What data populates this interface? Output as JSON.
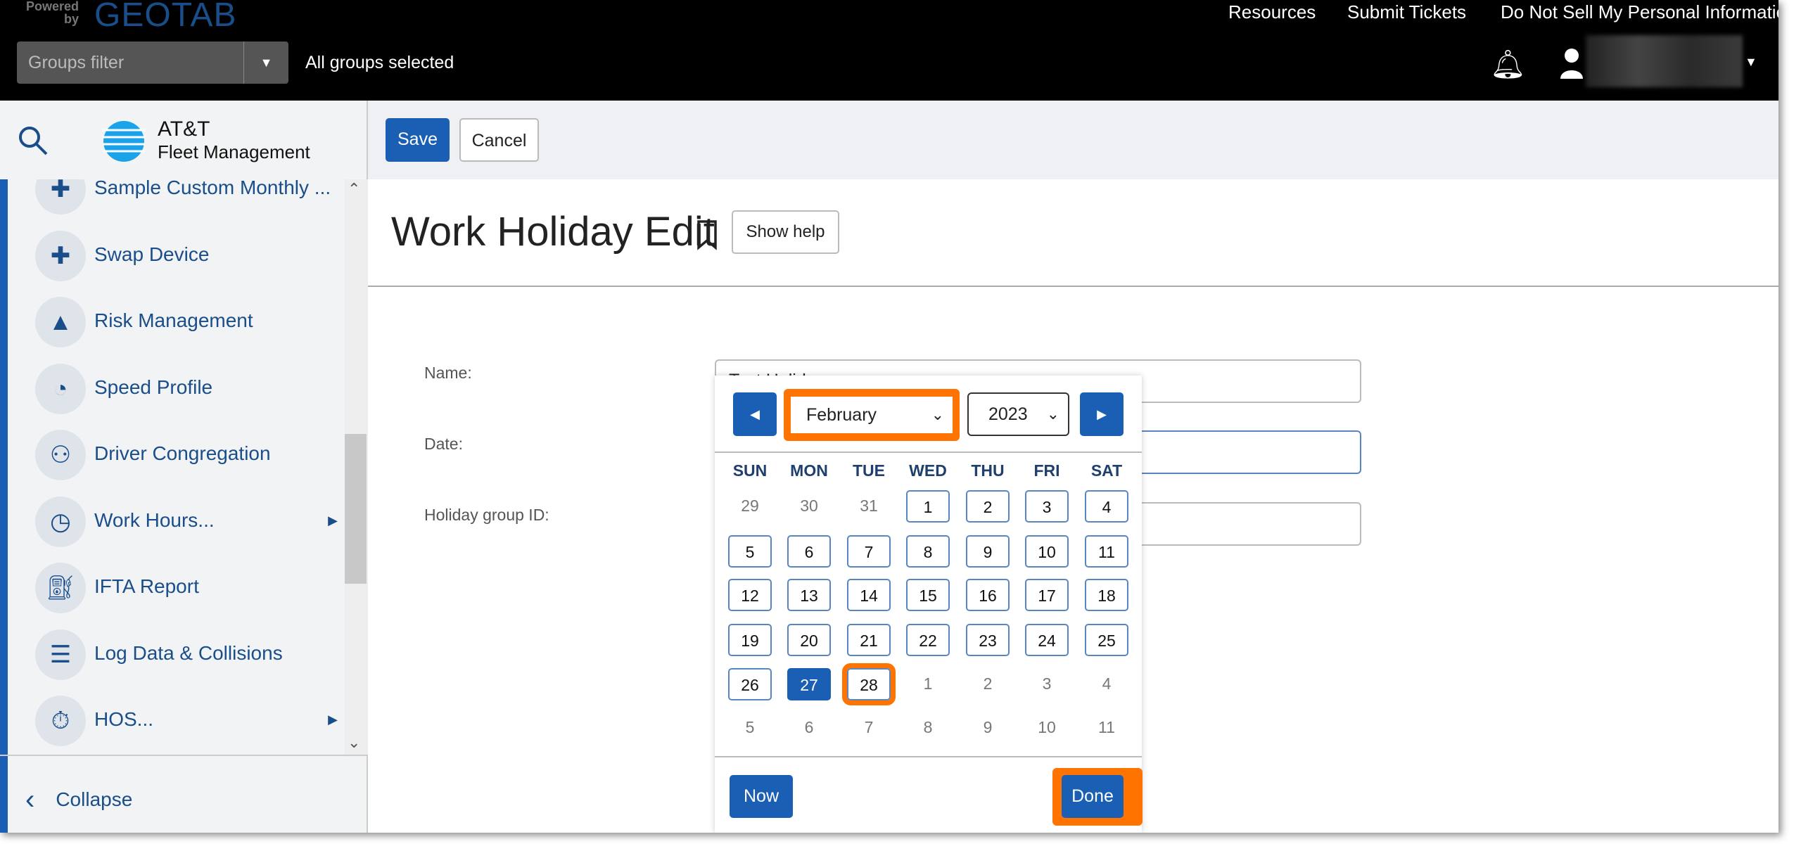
{
  "topbar": {
    "powered_by": "Powered by",
    "brand": "GEOTAB",
    "links": [
      "Resources",
      "Submit Tickets",
      "Do Not Sell My Personal Information"
    ],
    "groups_filter_placeholder": "Groups filter",
    "groups_status": "All groups selected"
  },
  "sidebar": {
    "logo_line1": "AT&T",
    "logo_line2": "Fleet Management",
    "items": [
      {
        "label": "Sample Custom Monthly ...",
        "icon": "puzzle-icon"
      },
      {
        "label": "Swap Device",
        "icon": "puzzle-icon"
      },
      {
        "label": "Risk Management",
        "icon": "risk-chart-icon"
      },
      {
        "label": "Speed Profile",
        "icon": "speedometer-icon"
      },
      {
        "label": "Driver Congregation",
        "icon": "people-pin-icon"
      },
      {
        "label": "Work Hours...",
        "icon": "clock-icon",
        "submenu": true
      },
      {
        "label": "IFTA Report",
        "icon": "fuel-can-icon"
      },
      {
        "label": "Log Data & Collisions",
        "icon": "list-warning-icon"
      },
      {
        "label": "HOS...",
        "icon": "stopwatch-icon",
        "submenu": true
      }
    ],
    "collapse_label": "Collapse"
  },
  "toolbar": {
    "save": "Save",
    "cancel": "Cancel"
  },
  "page": {
    "title": "Work Holiday Edit",
    "help": "Show help"
  },
  "form": {
    "name_label": "Name:",
    "name_value": "Test Holiday",
    "date_label": "Date:",
    "date_value": "",
    "group_label": "Holiday group ID:",
    "group_value": ""
  },
  "calendar": {
    "month": "February",
    "year": "2023",
    "weekdays": [
      "SUN",
      "MON",
      "TUE",
      "WED",
      "THU",
      "FRI",
      "SAT"
    ],
    "weeks": [
      [
        "29",
        "30",
        "31",
        "1",
        "2",
        "3",
        "4"
      ],
      [
        "5",
        "6",
        "7",
        "8",
        "9",
        "10",
        "11"
      ],
      [
        "12",
        "13",
        "14",
        "15",
        "16",
        "17",
        "18"
      ],
      [
        "19",
        "20",
        "21",
        "22",
        "23",
        "24",
        "25"
      ],
      [
        "26",
        "27",
        "28",
        "1",
        "2",
        "3",
        "4"
      ],
      [
        "5",
        "6",
        "7",
        "8",
        "9",
        "10",
        "11"
      ]
    ],
    "selected_day": "27",
    "highlighted_day": "28",
    "now": "Now",
    "done": "Done"
  },
  "colors": {
    "accent": "#1a5fb4",
    "highlight": "#ff7300"
  }
}
